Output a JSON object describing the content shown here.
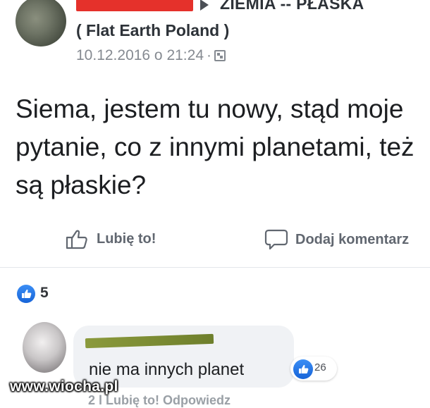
{
  "post": {
    "group_name": "ZIEMIA -- PŁASKA",
    "group_subtitle": "( Flat Earth Poland )",
    "timestamp": "10.12.2016 o 21:24",
    "separator": "·",
    "text": "Siema, jestem tu nowy, stąd moje pytanie, co z innymi planetami, też są płaskie?",
    "actions": {
      "like_label": "Lubię to!",
      "comment_label": "Dodaj komentarz"
    },
    "reaction_count": "5"
  },
  "comment": {
    "text": "nie ma innych planet",
    "like_count": "26",
    "sub_actions": "2 l   Lubię to!   Odpowiedz"
  },
  "watermark": "www.wiocha.pl",
  "colors": {
    "accent": "#1877f2",
    "redaction_red": "#e5312b",
    "redaction_green": "#7f8f35",
    "muted_text": "#858a91"
  },
  "icons": {
    "like": "thumbs-up-icon",
    "comment": "speech-bubble-icon",
    "privacy": "group-privacy-icon",
    "reaction": "like-reaction-icon"
  }
}
